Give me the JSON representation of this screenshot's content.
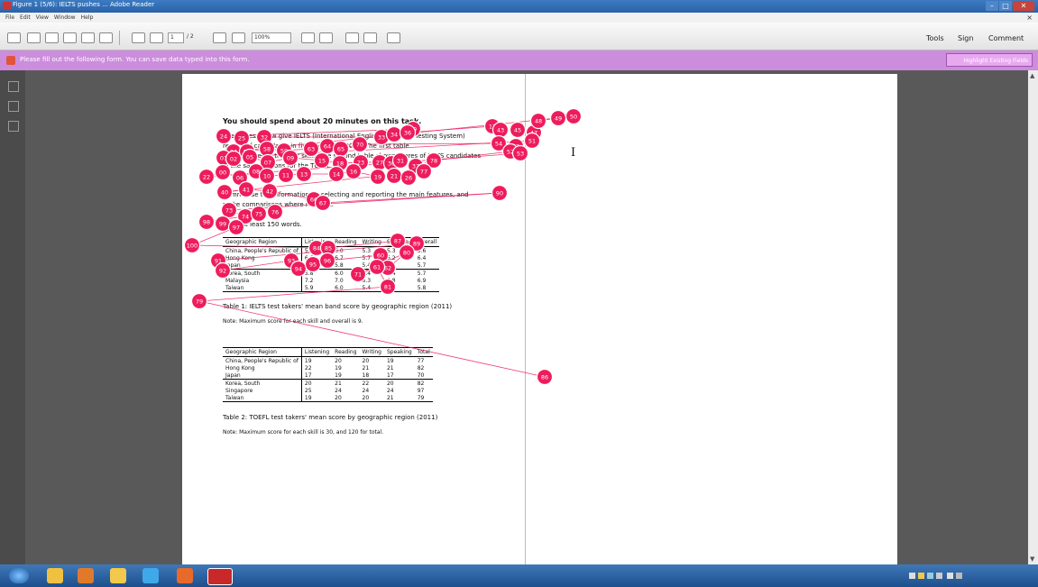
{
  "window": {
    "title": "Figure 1 (5/6): IELTS pushes ... Adobe Reader"
  },
  "menu": [
    "File",
    "Edit",
    "View",
    "Window",
    "Help"
  ],
  "toolbar": {
    "page_current": "1",
    "page_total": "/ 2",
    "zoom": "100%",
    "right_items": [
      "Tools",
      "Sign",
      "Comment"
    ]
  },
  "notification": {
    "text": "Please fill out the following form. You can save data typed into this form.",
    "button": "Highlight Existing Fields"
  },
  "document": {
    "heading": "You should spend about 20 minutes on this task.",
    "paragraph_lines": [
      "The tables below give IELTS (International English Language Testing System)",
      "results of candidates in five regions in 2011. The first table",
      "shows scores in the four skills, the second table shows scores of IELTS candidates",
      "in the same regions for the TOEFL test.",
      "Summarise the information by selecting and reporting the main features, and",
      "make comparisons where relevant.",
      "Write at least 150 words."
    ],
    "table1": {
      "headers": [
        "Geographic Region",
        "Listening",
        "Reading",
        "Writing",
        "Speaking",
        "Overall"
      ],
      "rows": [
        [
          "China, People's Republic of",
          "5.8",
          "6.0",
          "5.3",
          "5.3",
          "5.6"
        ],
        [
          "Hong Kong",
          "6.6",
          "6.7",
          "5.7",
          "6.2",
          "6.4"
        ],
        [
          "Japan",
          "5.8",
          "5.8",
          "5.4",
          "5.5",
          "5.7"
        ],
        [
          "Korea, South",
          "5.8",
          "6.0",
          "5.4",
          "5.4",
          "5.7"
        ],
        [
          "Malaysia",
          "7.2",
          "7.0",
          "6.3",
          "6.8",
          "6.9"
        ],
        [
          "Taiwan",
          "5.9",
          "6.0",
          "5.4",
          "5.8",
          "5.8"
        ]
      ],
      "caption": "Table 1: IELTS test takers' mean band score by geographic region (2011)",
      "note": "Note: Maximum score for each skill and overall is 9."
    },
    "table2": {
      "headers": [
        "Geographic Region",
        "Listening",
        "Reading",
        "Writing",
        "Speaking",
        "Total"
      ],
      "rows": [
        [
          "China, People's Republic of",
          "19",
          "20",
          "20",
          "19",
          "77"
        ],
        [
          "Hong Kong",
          "22",
          "19",
          "21",
          "21",
          "82"
        ],
        [
          "Japan",
          "17",
          "19",
          "18",
          "17",
          "70"
        ],
        [
          "Korea, South",
          "20",
          "21",
          "22",
          "20",
          "82"
        ],
        [
          "Singapore",
          "25",
          "24",
          "24",
          "24",
          "97"
        ],
        [
          "Taiwan",
          "19",
          "20",
          "20",
          "21",
          "79"
        ]
      ],
      "caption": "Table 2: TOEFL test takers' mean score by geographic region (2011)",
      "note": "Note: Maximum score for each skill is 30, and 120 for total."
    }
  },
  "gaze": {
    "color": "#ee1c5c",
    "fixations": [
      [
        458,
        143,
        "29"
      ],
      [
        248,
        151,
        "24"
      ],
      [
        268,
        153,
        "25"
      ],
      [
        293,
        152,
        "32"
      ],
      [
        423,
        152,
        "33"
      ],
      [
        437,
        149,
        "34"
      ],
      [
        452,
        147,
        "36"
      ],
      [
        546,
        140,
        "12"
      ],
      [
        555,
        144,
        "43"
      ],
      [
        574,
        144,
        "45"
      ],
      [
        592,
        147,
        "47"
      ],
      [
        597,
        134,
        "48"
      ],
      [
        619,
        131,
        "49"
      ],
      [
        636,
        129,
        "50"
      ],
      [
        259,
        168,
        "04"
      ],
      [
        274,
        168,
        "56"
      ],
      [
        296,
        165,
        "58"
      ],
      [
        315,
        167,
        "59"
      ],
      [
        345,
        165,
        "63"
      ],
      [
        363,
        162,
        "64"
      ],
      [
        378,
        165,
        "65"
      ],
      [
        399,
        160,
        "70"
      ],
      [
        553,
        159,
        "54"
      ],
      [
        572,
        162,
        "82"
      ],
      [
        590,
        156,
        "51"
      ],
      [
        248,
        175,
        "01"
      ],
      [
        259,
        176,
        "02"
      ],
      [
        277,
        174,
        "05"
      ],
      [
        297,
        180,
        "07"
      ],
      [
        322,
        175,
        "09"
      ],
      [
        357,
        178,
        "15"
      ],
      [
        377,
        181,
        "18"
      ],
      [
        400,
        180,
        "23"
      ],
      [
        421,
        180,
        "27"
      ],
      [
        434,
        181,
        "30"
      ],
      [
        444,
        178,
        "31"
      ],
      [
        461,
        184,
        "37"
      ],
      [
        481,
        178,
        "78"
      ],
      [
        566,
        168,
        "52"
      ],
      [
        577,
        170,
        "53"
      ],
      [
        229,
        196,
        "22"
      ],
      [
        247,
        191,
        "00"
      ],
      [
        266,
        197,
        "06"
      ],
      [
        284,
        190,
        "08"
      ],
      [
        296,
        195,
        "10"
      ],
      [
        317,
        194,
        "11"
      ],
      [
        337,
        193,
        "13"
      ],
      [
        373,
        193,
        "14"
      ],
      [
        392,
        190,
        "16"
      ],
      [
        419,
        196,
        "19"
      ],
      [
        437,
        195,
        "21"
      ],
      [
        453,
        197,
        "26"
      ],
      [
        470,
        190,
        "77"
      ],
      [
        249,
        213,
        "40"
      ],
      [
        273,
        210,
        "41"
      ],
      [
        299,
        212,
        "42"
      ],
      [
        348,
        221,
        "66"
      ],
      [
        358,
        225,
        "67"
      ],
      [
        554,
        214,
        "90"
      ],
      [
        254,
        233,
        "73"
      ],
      [
        272,
        240,
        "74"
      ],
      [
        287,
        237,
        "75"
      ],
      [
        305,
        235,
        "76"
      ],
      [
        229,
        246,
        "98"
      ],
      [
        247,
        248,
        "99"
      ],
      [
        262,
        252,
        "97"
      ],
      [
        213,
        272,
        "100"
      ],
      [
        351,
        275,
        "84"
      ],
      [
        364,
        275,
        "85"
      ],
      [
        441,
        267,
        "87"
      ],
      [
        462,
        270,
        "89"
      ],
      [
        242,
        289,
        "91"
      ],
      [
        247,
        300,
        "92"
      ],
      [
        323,
        289,
        "93"
      ],
      [
        331,
        298,
        "94"
      ],
      [
        347,
        293,
        "95"
      ],
      [
        363,
        289,
        "96"
      ],
      [
        422,
        283,
        "60"
      ],
      [
        430,
        297,
        "62"
      ],
      [
        451,
        280,
        "80"
      ],
      [
        397,
        304,
        "71"
      ],
      [
        418,
        296,
        "61"
      ],
      [
        430,
        318,
        "81"
      ],
      [
        221,
        334,
        "79"
      ],
      [
        604,
        418,
        "86"
      ]
    ]
  }
}
